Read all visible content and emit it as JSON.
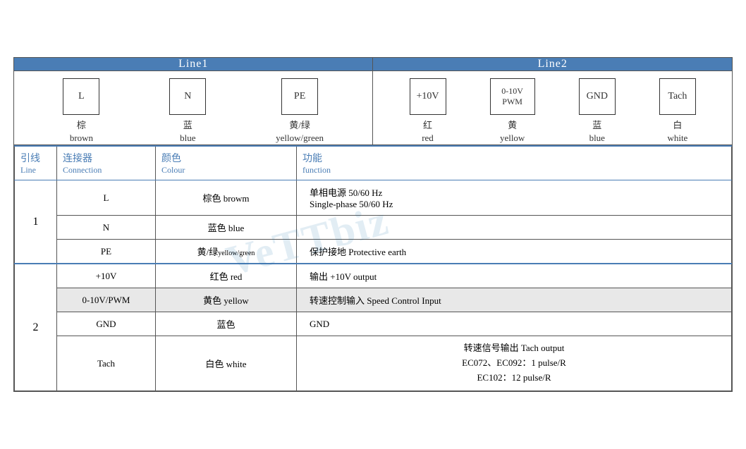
{
  "header": {
    "line1": "Line1",
    "line2": "Line2"
  },
  "line1_connectors": [
    {
      "label": "L",
      "cn": "棕",
      "en": "brown"
    },
    {
      "label": "N",
      "cn": "蓝",
      "en": "blue"
    },
    {
      "label": "PE",
      "cn": "黄/绿",
      "en": "yellow/green"
    }
  ],
  "line2_connectors": [
    {
      "label": "+10V",
      "cn": "红",
      "en": "red"
    },
    {
      "label": "0-10V\nPWM",
      "cn": "黄",
      "en": "yellow"
    },
    {
      "label": "GND",
      "cn": "蓝",
      "en": "blue"
    },
    {
      "label": "Tach",
      "cn": "白",
      "en": "white"
    }
  ],
  "col_headers": {
    "line_cn": "引线",
    "line_en": "Line",
    "conn_cn": "连接器",
    "conn_en": "Connection",
    "color_cn": "颜色",
    "color_en": "Colour",
    "func_cn": "功能",
    "func_en": "function"
  },
  "rows": [
    {
      "line": "1",
      "rowspan": 3,
      "entries": [
        {
          "conn": "L",
          "color": "棕色 browm",
          "func": "单相电源 50/60 Hz\nSingle-phase 50/60 Hz",
          "grey": false
        },
        {
          "conn": "N",
          "color": "蓝色 blue",
          "func": "",
          "grey": false
        },
        {
          "conn": "PE",
          "color": "黄/绿yellow/green",
          "func": "保护接地 Protective earth",
          "grey": false
        }
      ]
    },
    {
      "line": "2",
      "rowspan": 4,
      "entries": [
        {
          "conn": "+10V",
          "color": "红色 red",
          "func": "输出 +10V output",
          "grey": false
        },
        {
          "conn": "0-10V/PWM",
          "color": "黄色 yellow",
          "func": "转速控制输入 Speed Control Input",
          "grey": true
        },
        {
          "conn": "GND",
          "color": "蓝色",
          "func": "GND",
          "grey": false
        },
        {
          "conn": "Tach",
          "color": "白色 white",
          "func": "转速信号输出 Tach output\nEC072、EC092：1 pulse/R\nEC102：12 pulse/R",
          "grey": false
        }
      ]
    }
  ],
  "watermark": "VeTTbiz"
}
